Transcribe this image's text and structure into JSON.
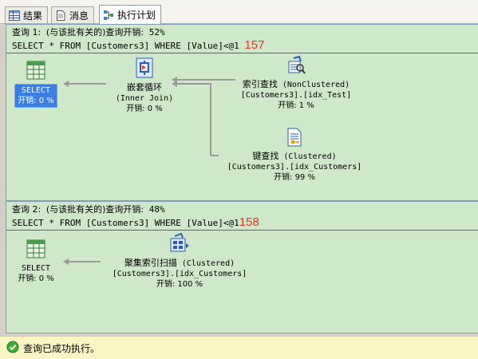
{
  "tabs": [
    {
      "label": "结果",
      "icon": "grid-icon",
      "active": false
    },
    {
      "label": "消息",
      "icon": "document-icon",
      "active": false
    },
    {
      "label": "执行计划",
      "icon": "execution-plan-icon",
      "active": true
    }
  ],
  "query1": {
    "title_prefix": "查询 1:",
    "title_relative": "(与该批有关的)",
    "title_cost_label": "查询开销:",
    "title_cost": "52%",
    "sql": "SELECT * FROM [Customers3] WHERE [Value]<@1",
    "annotation": "157",
    "nodes": {
      "select": {
        "name": "SELECT",
        "cost": "开销: 0 %",
        "icon": "select-result-icon"
      },
      "nested_loops": {
        "name": "嵌套循环",
        "sub": "(Inner Join)",
        "cost": "开销: 0 %",
        "icon": "nested-loops-icon"
      },
      "index_seek": {
        "name": "索引查找",
        "name_suffix": "(NonClustered)",
        "sub": "[Customers3].[idx_Test]",
        "cost": "开销: 1 %",
        "icon": "index-seek-icon"
      },
      "key_lookup": {
        "name": "键查找",
        "name_suffix": "(Clustered)",
        "sub": "[Customers3].[idx_Customers]",
        "cost": "开销: 99 %",
        "icon": "key-lookup-icon"
      }
    }
  },
  "query2": {
    "title_prefix": "查询 2:",
    "title_relative": "(与该批有关的)",
    "title_cost_label": "查询开销:",
    "title_cost": "48%",
    "sql": "SELECT * FROM [Customers3] WHERE [Value]<@1",
    "annotation": "158",
    "nodes": {
      "select": {
        "name": "SELECT",
        "cost": "开销: 0 %",
        "icon": "select-result-icon"
      },
      "clustered_scan": {
        "name": "聚集索引扫描",
        "name_suffix": "(Clustered)",
        "sub": "[Customers3].[idx_Customers]",
        "cost": "开销: 100 %",
        "icon": "clustered-index-scan-icon"
      }
    }
  },
  "status": {
    "text": "查询已成功执行。",
    "icon": "success-check-icon"
  }
}
